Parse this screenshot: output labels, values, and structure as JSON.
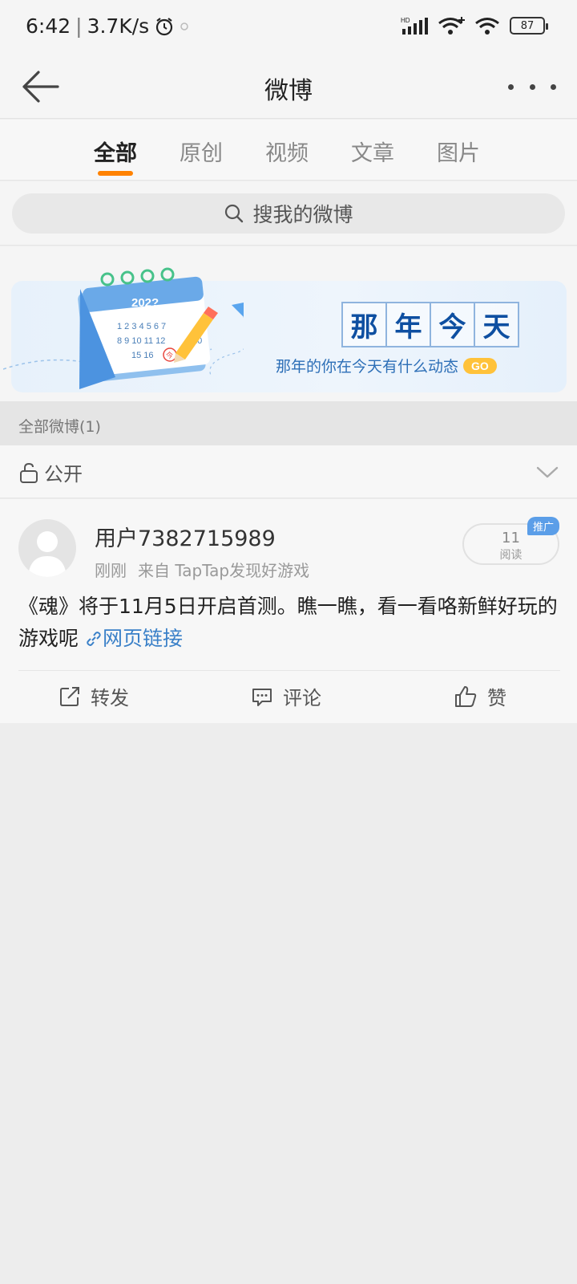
{
  "status_bar": {
    "time": "6:42",
    "speed": "3.7K/s",
    "network_label": "HD",
    "battery": "87"
  },
  "nav": {
    "title": "微博",
    "back_icon": "arrow-left-icon",
    "more_icon": "more-dots-icon"
  },
  "tabs": [
    {
      "label": "全部",
      "active": true
    },
    {
      "label": "原创",
      "active": false
    },
    {
      "label": "视频",
      "active": false
    },
    {
      "label": "文章",
      "active": false
    },
    {
      "label": "图片",
      "active": false
    }
  ],
  "search": {
    "placeholder": "搜我的微博"
  },
  "banner": {
    "title_chars": [
      "那",
      "年",
      "今",
      "天"
    ],
    "subtitle": "那年的你在今天有什么动态",
    "go_label": "GO",
    "calendar_year": "202?",
    "calendar_rows": [
      "1 2 3 4 5 6 7",
      "8 9 10 11 12",
      "15 16"
    ],
    "calendar_highlight": "今",
    "calendar_side": "20"
  },
  "section": {
    "title": "全部微博(1)"
  },
  "visibility": {
    "label": "公开"
  },
  "post": {
    "username": "用户7382715989",
    "time": "刚刚",
    "source": "来自 TapTap发现好游戏",
    "read_count": "11",
    "read_label": "阅读",
    "promo_tag": "推广",
    "text": "《魂》将于11月5日开启首测。瞧一瞧，看一看咯新鲜好玩的游戏呢",
    "link_label": "网页链接"
  },
  "actions": {
    "repost": "转发",
    "comment": "评论",
    "like": "赞"
  },
  "colors": {
    "accent": "#ff8200",
    "link": "#3a80c8",
    "banner_blue": "#0e4fa1",
    "go_yellow": "#ffc23a"
  }
}
